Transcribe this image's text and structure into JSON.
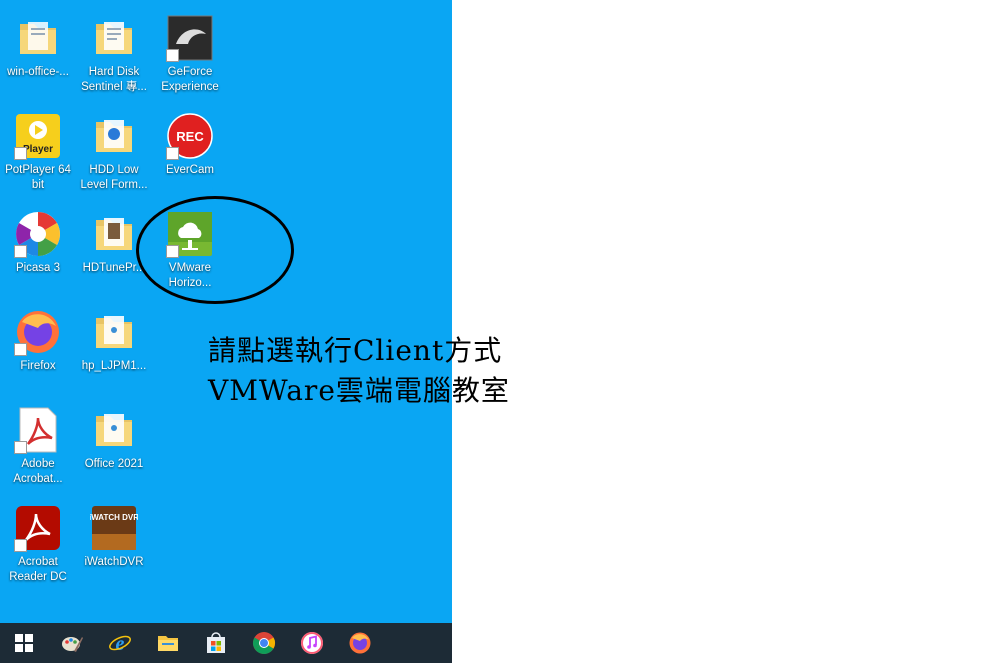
{
  "desktop": {
    "icons": [
      {
        "label": "win-office-...",
        "icon": "folder-icon"
      },
      {
        "label": "Hard Disk Sentinel 專...",
        "icon": "folder-doc-icon"
      },
      {
        "label": "GeForce Experience",
        "icon": "geforce-icon"
      },
      {
        "label": "PotPlayer 64 bit",
        "icon": "potplayer-icon",
        "badge": "Player"
      },
      {
        "label": "HDD Low Level Form...",
        "icon": "folder-doc-icon"
      },
      {
        "label": "EverCam",
        "icon": "evercam-icon",
        "badge": "REC"
      },
      {
        "label": "Picasa 3",
        "icon": "picasa-icon"
      },
      {
        "label": "HDTunePr...",
        "icon": "folder-doc-icon"
      },
      {
        "label": "VMware Horizo...",
        "icon": "vmware-horizon-icon"
      },
      {
        "label": "Firefox",
        "icon": "firefox-icon"
      },
      {
        "label": "hp_LJPM1...",
        "icon": "folder-doc-icon"
      },
      {
        "label": "Adobe Acrobat...",
        "icon": "adobe-acrobat-icon"
      },
      {
        "label": "Office 2021",
        "icon": "folder-doc-icon"
      },
      {
        "label": "Acrobat Reader DC",
        "icon": "acrobat-reader-icon"
      },
      {
        "label": "iWatchDVR",
        "icon": "iwatchdvr-icon",
        "badge": "iWATCH DVR"
      }
    ]
  },
  "annotation": {
    "line1": "請點選執行Client方式",
    "line2": "VMWare雲端電腦教室"
  },
  "taskbar": {
    "items": [
      {
        "icon": "windows-start-icon"
      },
      {
        "icon": "paint-icon"
      },
      {
        "icon": "internet-explorer-icon"
      },
      {
        "icon": "file-explorer-icon"
      },
      {
        "icon": "microsoft-store-icon"
      },
      {
        "icon": "chrome-icon"
      },
      {
        "icon": "itunes-icon"
      },
      {
        "icon": "firefox-icon"
      }
    ]
  },
  "colors": {
    "desktop_bg": "#0aa6f3",
    "taskbar_bg": "#1d2b36"
  }
}
